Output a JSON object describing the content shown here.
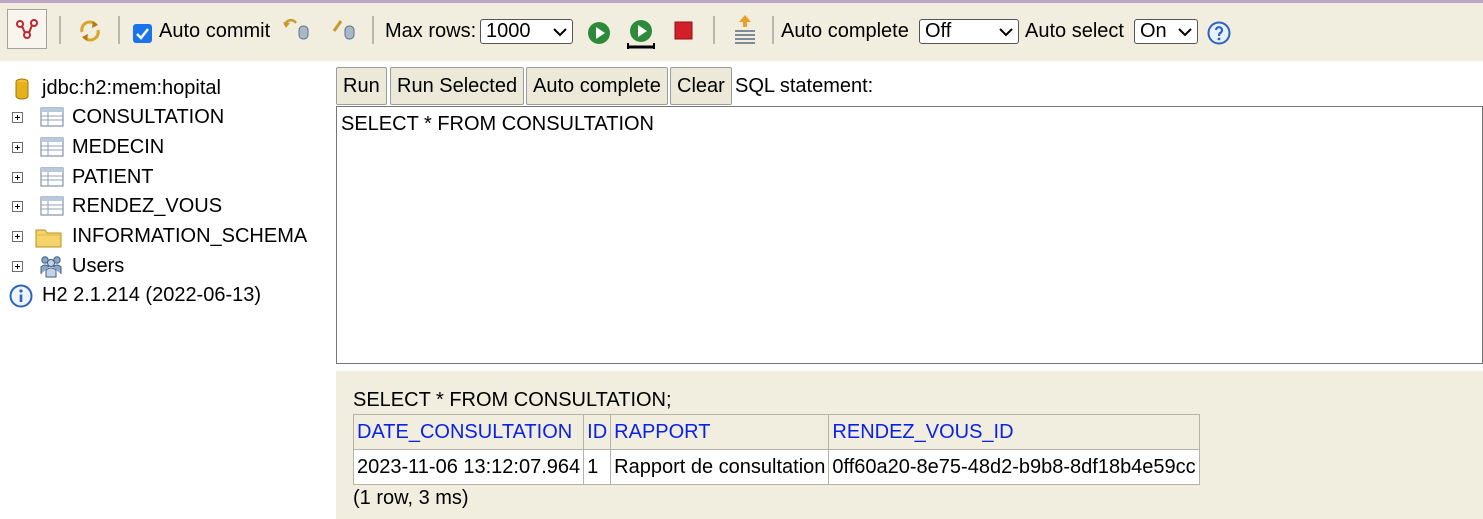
{
  "toolbar": {
    "auto_commit_label": "Auto commit",
    "auto_commit_checked": true,
    "max_rows_label": "Max rows:",
    "max_rows_value": "1000",
    "auto_complete_label": "Auto complete",
    "auto_complete_value": "Off",
    "auto_select_label": "Auto select",
    "auto_select_value": "On"
  },
  "sidebar": {
    "connection": "jdbc:h2:mem:hopital",
    "items": [
      {
        "label": "CONSULTATION",
        "icon": "table-icon"
      },
      {
        "label": "MEDECIN",
        "icon": "table-icon"
      },
      {
        "label": "PATIENT",
        "icon": "table-icon"
      },
      {
        "label": "RENDEZ_VOUS",
        "icon": "table-icon"
      },
      {
        "label": "INFORMATION_SCHEMA",
        "icon": "folder-icon"
      },
      {
        "label": "Users",
        "icon": "users-icon"
      }
    ],
    "version": "H2 2.1.214 (2022-06-13)"
  },
  "editor": {
    "run_label": "Run",
    "run_selected_label": "Run Selected",
    "auto_complete_label": "Auto complete",
    "clear_label": "Clear",
    "sql_label": "SQL statement:",
    "sql_text": "SELECT * FROM CONSULTATION"
  },
  "results": {
    "query": "SELECT * FROM CONSULTATION;",
    "columns": [
      "DATE_CONSULTATION",
      "ID",
      "RAPPORT",
      "RENDEZ_VOUS_ID"
    ],
    "rows": [
      [
        "2023-11-06 13:12:07.964",
        "1",
        "Rapport de consultation",
        "0ff60a20-8e75-48d2-b9b8-8df18b4e59cc"
      ]
    ],
    "status": "(1 row, 3 ms)"
  },
  "colors": {
    "toolbar_bg": "#f1eddf",
    "header_text": "#0a22e6",
    "checkbox": "#1a73e8"
  }
}
